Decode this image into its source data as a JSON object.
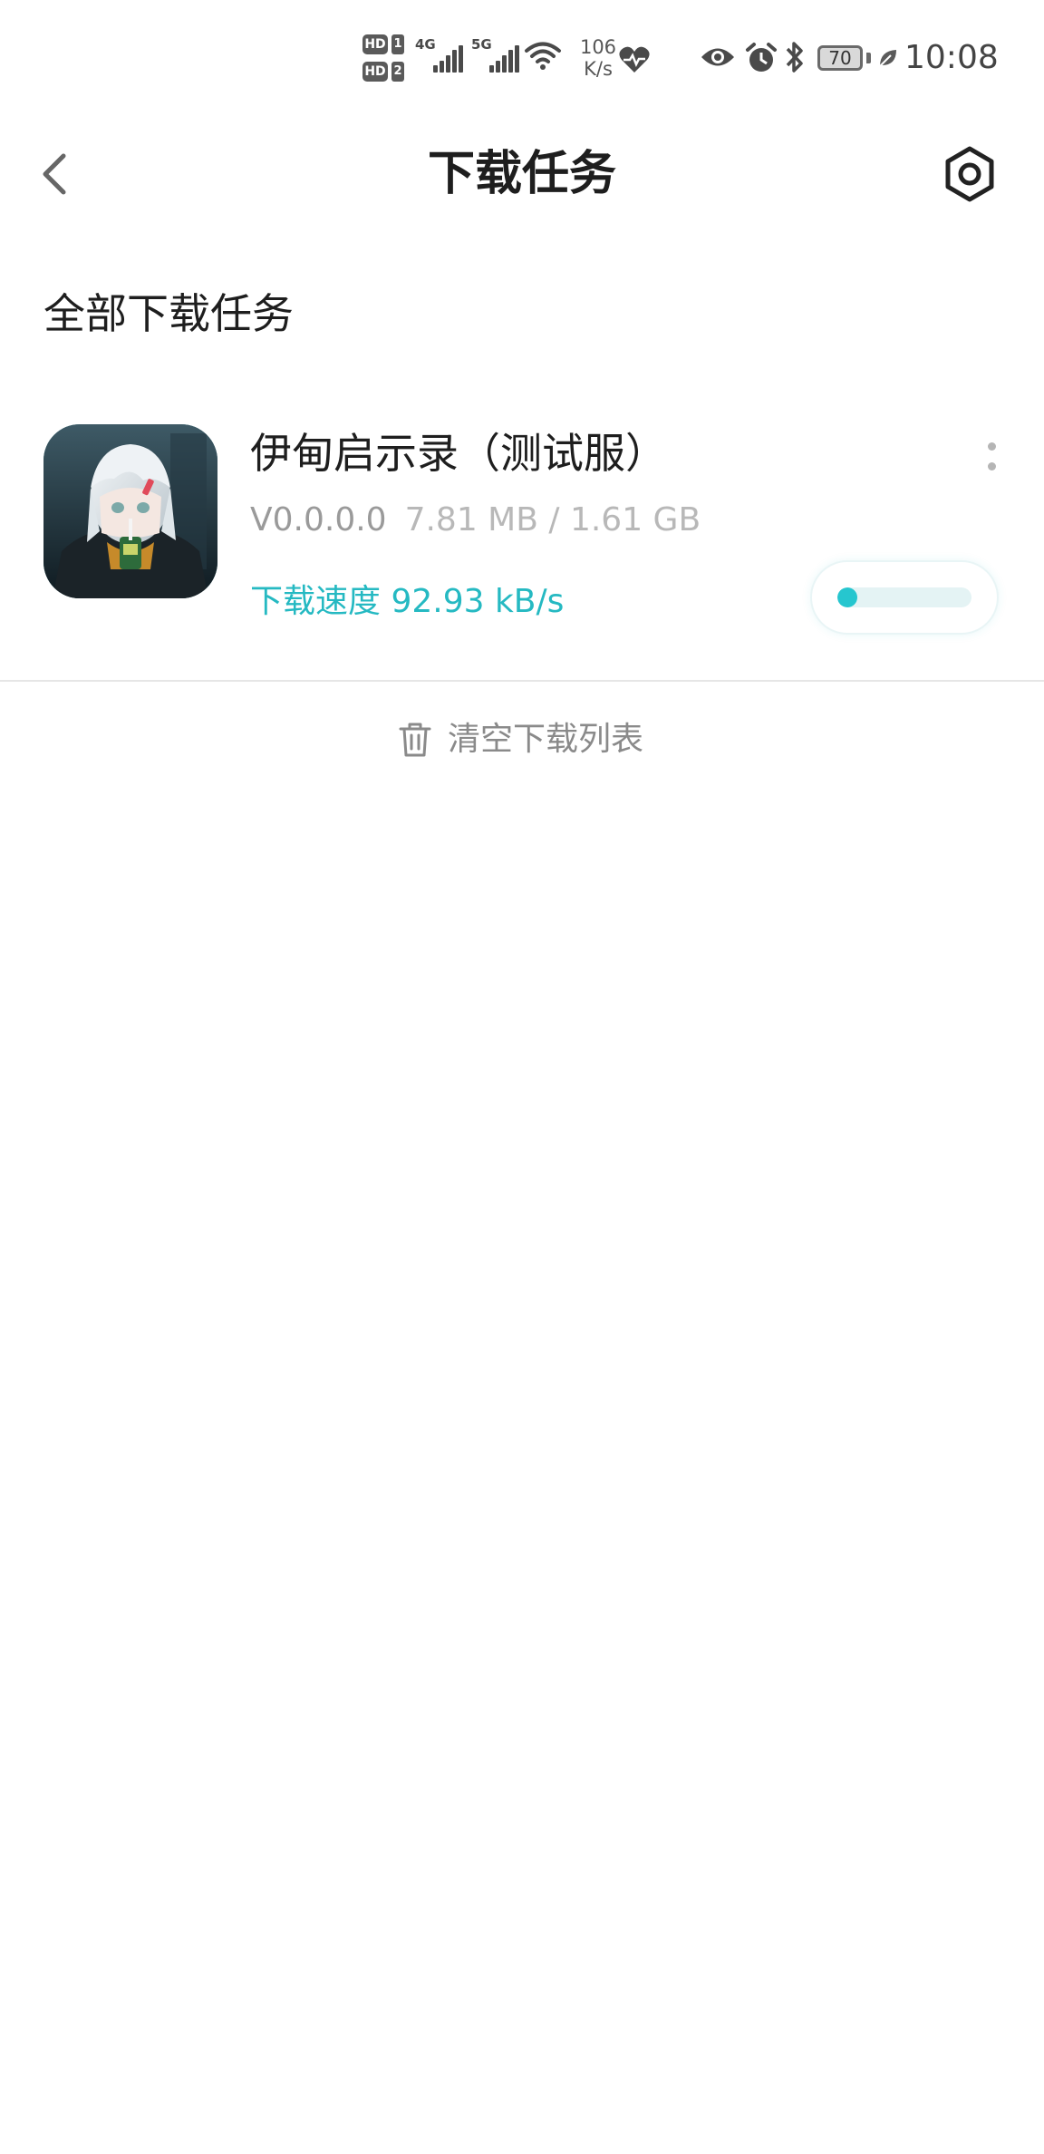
{
  "status_bar": {
    "sim1_badge": "HD",
    "sim1_number": "1",
    "sim2_badge": "HD",
    "sim2_number": "2",
    "network1": "4G",
    "network2": "5G",
    "speed_value": "106",
    "speed_unit": "K/s",
    "battery": "70",
    "time": "10:08",
    "icons": [
      "hd-icon",
      "signal-icon",
      "wifi-icon",
      "heart-icon",
      "eye-icon",
      "alarm-icon",
      "bluetooth-icon",
      "battery-icon",
      "leaf-icon"
    ]
  },
  "header": {
    "title": "下载任务",
    "back_icon": "chevron-left-icon",
    "settings_icon": "hex-settings-icon"
  },
  "section": {
    "title": "全部下载任务"
  },
  "tasks": [
    {
      "name": "伊甸启示录（测试服）",
      "version": "V0.0.0.0",
      "size": "7.81 MB / 1.61 GB",
      "speed": "下载速度 92.93 kB/s",
      "progress": 0.005,
      "accent": "#25b9c2"
    }
  ],
  "footer": {
    "clear_label": "清空下载列表",
    "clear_icon": "trash-icon"
  }
}
